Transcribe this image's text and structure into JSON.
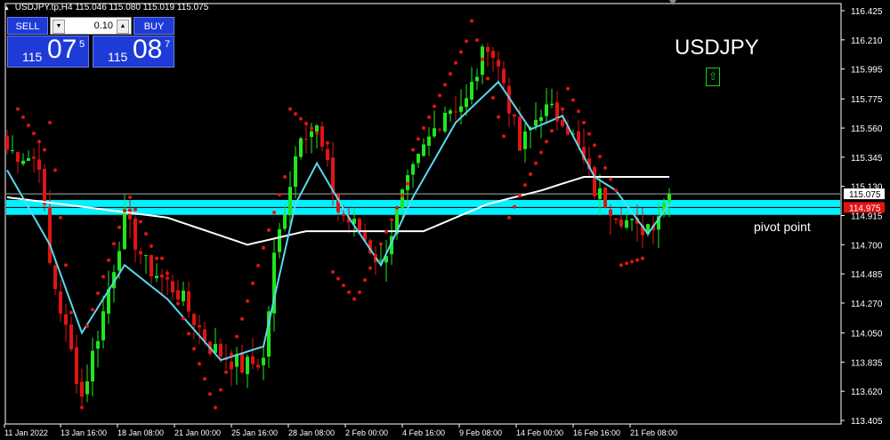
{
  "header": {
    "symbol_tf": "USDJPY.tp,H4",
    "ohlc": "115.046 115.080 115.019 115.075"
  },
  "trade_panel": {
    "sell_label": "SELL",
    "buy_label": "BUY",
    "lot_value": "0.10",
    "sell_price": {
      "prefix": "115",
      "big": "07",
      "sup": "5"
    },
    "buy_price": {
      "prefix": "115",
      "big": "08",
      "sup": "7"
    }
  },
  "symbol_label": "USDJPY",
  "arrow_label": "⇧",
  "pivot_label": "pivot point",
  "current_price_label": "115.075",
  "pivot_price_label": "114.975",
  "colors": {
    "bull": "#1fe61f",
    "bear": "#e01414",
    "sar": "#e01414",
    "fast_ma": "#5ad8ee",
    "slow_ma": "#ffffff",
    "zone": "#00f2ff",
    "bg": "#000000"
  },
  "chart_data": {
    "type": "candlestick",
    "y_range": [
      113.405,
      116.49
    ],
    "y_ticks": [
      "116.425",
      "116.210",
      "115.995",
      "115.775",
      "115.560",
      "115.345",
      "115.130",
      "114.915",
      "114.700",
      "114.485",
      "114.270",
      "114.050",
      "113.835",
      "113.620",
      "113.405"
    ],
    "x_ticks": [
      "11 Jan 2022",
      "13 Jan 16:00",
      "18 Jan 08:00",
      "21 Jan 00:00",
      "25 Jan 16:00",
      "28 Jan 08:00",
      "2 Feb 00:00",
      "4 Feb 16:00",
      "9 Feb 08:00",
      "14 Feb 00:00",
      "16 Feb 16:00",
      "21 Feb 08:00"
    ],
    "bars": 125,
    "close_anchors": [
      [
        0,
        115.4
      ],
      [
        6,
        115.32
      ],
      [
        8,
        114.55
      ],
      [
        14,
        113.58
      ],
      [
        18,
        114.2
      ],
      [
        22,
        114.9
      ],
      [
        26,
        114.55
      ],
      [
        32,
        114.35
      ],
      [
        38,
        113.95
      ],
      [
        44,
        113.8
      ],
      [
        48,
        113.85
      ],
      [
        50,
        114.6
      ],
      [
        55,
        115.55
      ],
      [
        58,
        115.55
      ],
      [
        62,
        114.95
      ],
      [
        66,
        114.8
      ],
      [
        70,
        114.55
      ],
      [
        74,
        115.05
      ],
      [
        78,
        115.4
      ],
      [
        82,
        115.7
      ],
      [
        86,
        115.75
      ],
      [
        90,
        116.2
      ],
      [
        93,
        115.9
      ],
      [
        96,
        115.4
      ],
      [
        100,
        115.7
      ],
      [
        104,
        115.65
      ],
      [
        107,
        115.4
      ],
      [
        110,
        115.1
      ],
      [
        114,
        114.95
      ],
      [
        118,
        114.8
      ],
      [
        121,
        114.88
      ],
      [
        124,
        115.075
      ]
    ],
    "fast_ma_anchors": [
      [
        0,
        115.25
      ],
      [
        8,
        114.7
      ],
      [
        14,
        114.05
      ],
      [
        22,
        114.55
      ],
      [
        30,
        114.3
      ],
      [
        40,
        113.85
      ],
      [
        48,
        113.95
      ],
      [
        54,
        115.0
      ],
      [
        58,
        115.3
      ],
      [
        64,
        114.9
      ],
      [
        70,
        114.55
      ],
      [
        76,
        115.05
      ],
      [
        84,
        115.6
      ],
      [
        92,
        115.9
      ],
      [
        98,
        115.55
      ],
      [
        104,
        115.65
      ],
      [
        110,
        115.2
      ],
      [
        114,
        115.1
      ],
      [
        120,
        114.78
      ],
      [
        124,
        115.0
      ]
    ],
    "slow_ma_anchors": [
      [
        0,
        115.05
      ],
      [
        10,
        115.0
      ],
      [
        20,
        114.95
      ],
      [
        30,
        114.9
      ],
      [
        45,
        114.7
      ],
      [
        56,
        114.8
      ],
      [
        66,
        114.8
      ],
      [
        78,
        114.8
      ],
      [
        90,
        115.0
      ],
      [
        100,
        115.1
      ],
      [
        108,
        115.2
      ],
      [
        116,
        115.2
      ],
      [
        124,
        115.2
      ]
    ],
    "sar_segments": [
      [
        2,
        7,
        115.7,
        115.4
      ],
      [
        8,
        14,
        115.6,
        113.5
      ],
      [
        15,
        22,
        114.1,
        114.95
      ],
      [
        23,
        28,
        115.05,
        114.6
      ],
      [
        29,
        38,
        114.6,
        113.6
      ],
      [
        39,
        52,
        113.5,
        115.2
      ],
      [
        53,
        60,
        115.7,
        115.45
      ],
      [
        61,
        65,
        114.5,
        114.3
      ],
      [
        66,
        75,
        114.35,
        115.15
      ],
      [
        76,
        86,
        115.4,
        116.2
      ],
      [
        87,
        93,
        116.35,
        115.5
      ],
      [
        94,
        104,
        114.9,
        115.7
      ],
      [
        105,
        114,
        115.85,
        115.1
      ],
      [
        115,
        119,
        114.55,
        114.6
      ]
    ],
    "pivot_zone": [
      114.92,
      115.03
    ],
    "pivot_line": 114.975,
    "current_price": 115.075
  }
}
